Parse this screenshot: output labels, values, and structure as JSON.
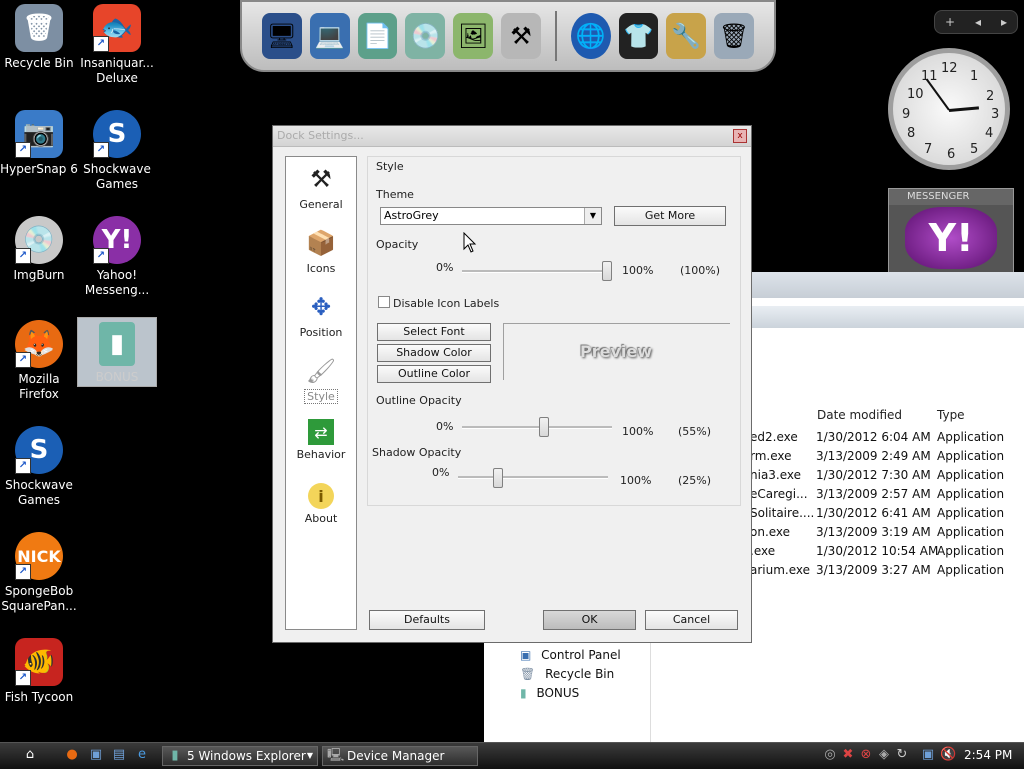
{
  "desktop": {
    "icons": [
      {
        "label": "Recycle Bin",
        "icon": "recycle-bin-icon",
        "color": "#7d8fa3"
      },
      {
        "label": "Insaniquar... Deluxe",
        "icon": "fish-icon",
        "color": "#e7452a"
      },
      {
        "label": "HyperSnap 6",
        "icon": "camera-icon",
        "color": "#3a7bc8"
      },
      {
        "label": "Shockwave Games",
        "icon": "shockwave-icon",
        "color": "#1b5fb5"
      },
      {
        "label": "ImgBurn",
        "icon": "disc-icon",
        "color": "#c9c9c9"
      },
      {
        "label": "Yahoo! Messeng...",
        "icon": "yahoo-icon",
        "color": "#8a2fa6"
      },
      {
        "label": "Mozilla Firefox",
        "icon": "firefox-icon",
        "color": "#e86a12"
      },
      {
        "label": "BONUS",
        "icon": "folder-icon",
        "color": "#6fb6a8"
      },
      {
        "label": "Shockwave Games",
        "icon": "shockwave-icon",
        "color": "#1b5fb5"
      },
      {
        "label": "SpongeBob SquarePan...",
        "icon": "nick-icon",
        "color": "#f07a12"
      },
      {
        "label": "Fish Tycoon",
        "icon": "parrot-fish-icon",
        "color": "#c7241f"
      }
    ]
  },
  "dock": {
    "items": [
      "monitor-icon",
      "computer-icon",
      "documents-icon",
      "disc-folder-icon",
      "pictures-icon",
      "tools-icon",
      "globe-icon",
      "tshirt-icon",
      "settings-icon",
      "trash-icon"
    ]
  },
  "widgets": {
    "bar_buttons": [
      "+",
      "◂",
      "▸"
    ],
    "clock_numbers": [
      "12",
      "1",
      "2",
      "3",
      "4",
      "5",
      "6",
      "7",
      "8",
      "9",
      "10",
      "11"
    ],
    "yahoo_header": "MESSENGER",
    "yahoo_logo": "Y!"
  },
  "explorer": {
    "columns": {
      "date": "Date modified",
      "type": "Type"
    },
    "rows": [
      {
        "name": "ed2.exe",
        "date": "1/30/2012 6:04 AM",
        "type": "Application"
      },
      {
        "name": "rm.exe",
        "date": "3/13/2009 2:49 AM",
        "type": "Application"
      },
      {
        "name": "nia3.exe",
        "date": "1/30/2012 7:30 AM",
        "type": "Application"
      },
      {
        "name": "eCaregi...",
        "date": "3/13/2009 2:57 AM",
        "type": "Application"
      },
      {
        "name": "Solitaire....",
        "date": "1/30/2012 6:41 AM",
        "type": "Application"
      },
      {
        "name": "on.exe",
        "date": "3/13/2009 3:19 AM",
        "type": "Application"
      },
      {
        "name": ".exe",
        "date": "1/30/2012 10:54 AM",
        "type": "Application"
      },
      {
        "name": "arium.exe",
        "date": "3/13/2009 3:27 AM",
        "type": "Application"
      }
    ],
    "tree": [
      "Control Panel",
      "Recycle Bin",
      "BONUS"
    ]
  },
  "dialog": {
    "title": "Dock Settings...",
    "close": "x",
    "sidebar": [
      {
        "label": "General",
        "icon": "hammer-icon"
      },
      {
        "label": "Icons",
        "icon": "box-icon"
      },
      {
        "label": "Position",
        "icon": "position-arrows-icon"
      },
      {
        "label": "Style",
        "icon": "brush-icon"
      },
      {
        "label": "Behavior",
        "icon": "behavior-icon"
      },
      {
        "label": "About",
        "icon": "info-icon"
      }
    ],
    "section_title": "Style",
    "theme_label": "Theme",
    "theme_value": "AstroGrey",
    "get_more": "Get More",
    "opacity_label": "Opacity",
    "opacity_min": "0%",
    "opacity_max": "100%",
    "opacity_value": "(100%)",
    "disable_labels": "Disable Icon Labels",
    "select_font": "Select Font",
    "shadow_color": "Shadow Color",
    "outline_color": "Outline Color",
    "preview": "Preview",
    "outline_opacity_label": "Outline Opacity",
    "outline_min": "0%",
    "outline_max": "100%",
    "outline_value": "(55%)",
    "shadow_opacity_label": "Shadow Opacity",
    "shadow_min": "0%",
    "shadow_max": "100%",
    "shadow_value": "(25%)",
    "defaults": "Defaults",
    "ok": "OK",
    "cancel": "Cancel"
  },
  "taskbar": {
    "explorer_btn": "5 Windows Explorer",
    "device_manager_btn": "Device Manager",
    "time": "2:54 PM"
  }
}
